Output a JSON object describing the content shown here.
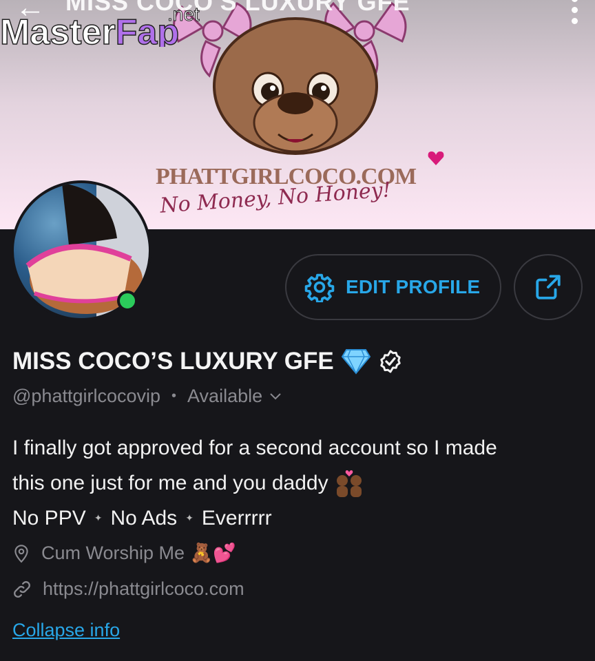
{
  "header": {
    "title": "MISS COCO'S LUXURY GFE",
    "back_icon": "back-arrow-icon",
    "menu_icon": "kebab-menu-icon"
  },
  "watermark": {
    "text_main": "MasterFap",
    "text_sub": ".net"
  },
  "banner": {
    "brand": "PHATTGIRLCOCO.COM",
    "tagline": "No Money, No Honey!",
    "colors": {
      "top": "#b9b2b8",
      "bottom": "#fde7f4"
    }
  },
  "profile": {
    "online": true,
    "edit_label": "EDIT PROFILE",
    "share_icon": "share-icon",
    "name": "MISS COCO’S LUXURY GFE",
    "handle": "@phattgirlcocovip",
    "status": "Available",
    "bio": {
      "line1": "I finally got approved for a second account so I made",
      "line2": "this one just for me and you daddy",
      "tags": [
        "No PPV",
        "No Ads",
        "Everrrrr"
      ]
    },
    "location": "Cum Worship Me 🧸💕",
    "website": "https://phattgirlcoco.com",
    "collapse_label": "Collapse info"
  },
  "colors": {
    "accent": "#28a7e8",
    "online": "#2bcb5b",
    "background": "#16161a"
  }
}
